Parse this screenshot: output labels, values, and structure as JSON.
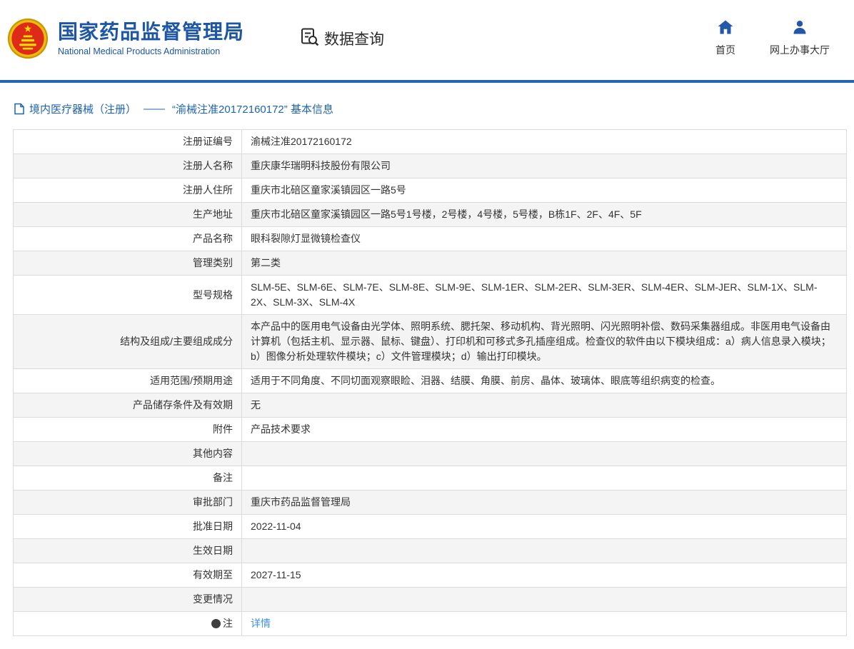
{
  "header": {
    "org_name_cn": "国家药品监督管理局",
    "org_name_en": "National Medical Products Administration",
    "section_title": "数据查询",
    "nav": [
      {
        "label": "首页",
        "icon": "home-icon"
      },
      {
        "label": "网上办事大厅",
        "icon": "person-icon"
      }
    ]
  },
  "colors": {
    "primary_blue": "#2566ae",
    "title_blue": "#1c56a5",
    "link_blue": "#3a8ee6",
    "emblem_red": "#de2a18",
    "emblem_gold": "#ffde00"
  },
  "breadcrumb": {
    "category": "境内医疗器械（注册）",
    "separator": "——",
    "title": "“渝械注准20172160172” 基本信息"
  },
  "table": {
    "rows": [
      {
        "label": "注册证编号",
        "value": "渝械注准20172160172"
      },
      {
        "label": "注册人名称",
        "value": "重庆康华瑞明科技股份有限公司"
      },
      {
        "label": "注册人住所",
        "value": "重庆市北碚区童家溪镇园区一路5号"
      },
      {
        "label": "生产地址",
        "value": "重庆市北碚区童家溪镇园区一路5号1号楼，2号楼，4号楼，5号楼，B栋1F、2F、4F、5F"
      },
      {
        "label": "产品名称",
        "value": "眼科裂隙灯显微镜检查仪"
      },
      {
        "label": "管理类别",
        "value": "第二类"
      },
      {
        "label": "型号规格",
        "value": "SLM-5E、SLM-6E、SLM-7E、SLM-8E、SLM-9E、SLM-1ER、SLM-2ER、SLM-3ER、SLM-4ER、SLM-JER、SLM-1X、SLM-2X、SLM-3X、SLM-4X"
      },
      {
        "label": "结构及组成/主要组成成分",
        "value": "本产品中的医用电气设备由光学体、照明系统、腮托架、移动机构、背光照明、闪光照明补偿、数码采集器组成。非医用电气设备由计算机（包括主机、显示器、鼠标、键盘）、打印机和可移式多孔插座组成。检查仪的软件由以下模块组成：a）病人信息录入模块；b）图像分析处理软件模块；c）文件管理模块；d）输出打印模块。"
      },
      {
        "label": "适用范围/预期用途",
        "value": "适用于不同角度、不同切面观察眼睑、泪器、结膜、角膜、前房、晶体、玻璃体、眼底等组织病变的检查。"
      },
      {
        "label": "产品储存条件及有效期",
        "value": "无"
      },
      {
        "label": "附件",
        "value": "产品技术要求"
      },
      {
        "label": "其他内容",
        "value": ""
      },
      {
        "label": "备注",
        "value": ""
      },
      {
        "label": "审批部门",
        "value": "重庆市药品监督管理局"
      },
      {
        "label": "批准日期",
        "value": "2022-11-04"
      },
      {
        "label": "生效日期",
        "value": ""
      },
      {
        "label": "有效期至",
        "value": "2027-11-15"
      },
      {
        "label": "变更情况",
        "value": ""
      },
      {
        "label": "注",
        "value": "详情",
        "icon": "dot",
        "link": true
      }
    ]
  }
}
